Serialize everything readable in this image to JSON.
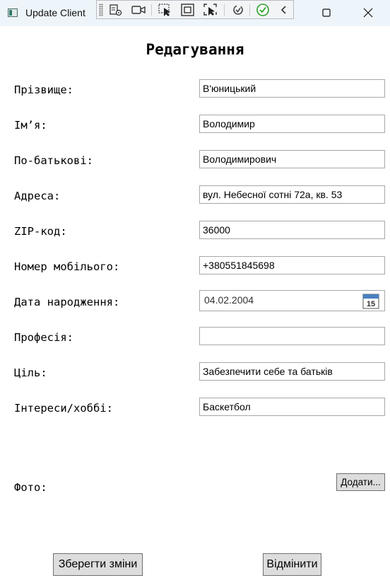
{
  "window": {
    "title": "Update Client"
  },
  "heading": "Редагування",
  "fields": [
    {
      "label": "Прізвище:",
      "value": "В'юницький"
    },
    {
      "label": "Ім’я:",
      "value": "Володимир"
    },
    {
      "label": "По-батькові:",
      "value": "Володимирович"
    },
    {
      "label": "Адреса:",
      "value": "вул. Небесної сотні 72а, кв. 53"
    },
    {
      "label": "ZIP-код:",
      "value": "36000"
    },
    {
      "label": "Номер мобілього:",
      "value": "+380551845698"
    },
    {
      "label": "Дата народження:",
      "value": "04.02.2004",
      "calendar_day": "15"
    },
    {
      "label": "Професія:",
      "value": ""
    },
    {
      "label": "Ціль:",
      "value": "Забезпечити себе та батьків"
    },
    {
      "label": "Інтереси/хоббі:",
      "value": "Баскетбол"
    }
  ],
  "photo": {
    "label": "Фото:",
    "add_button": "Додати..."
  },
  "buttons": {
    "save": "Зберегти зміни",
    "cancel": "Відмінити"
  },
  "colors": {
    "titlebar": "#eef5fa",
    "button_face": "#dddddd",
    "field_border": "#a8a8a8"
  }
}
